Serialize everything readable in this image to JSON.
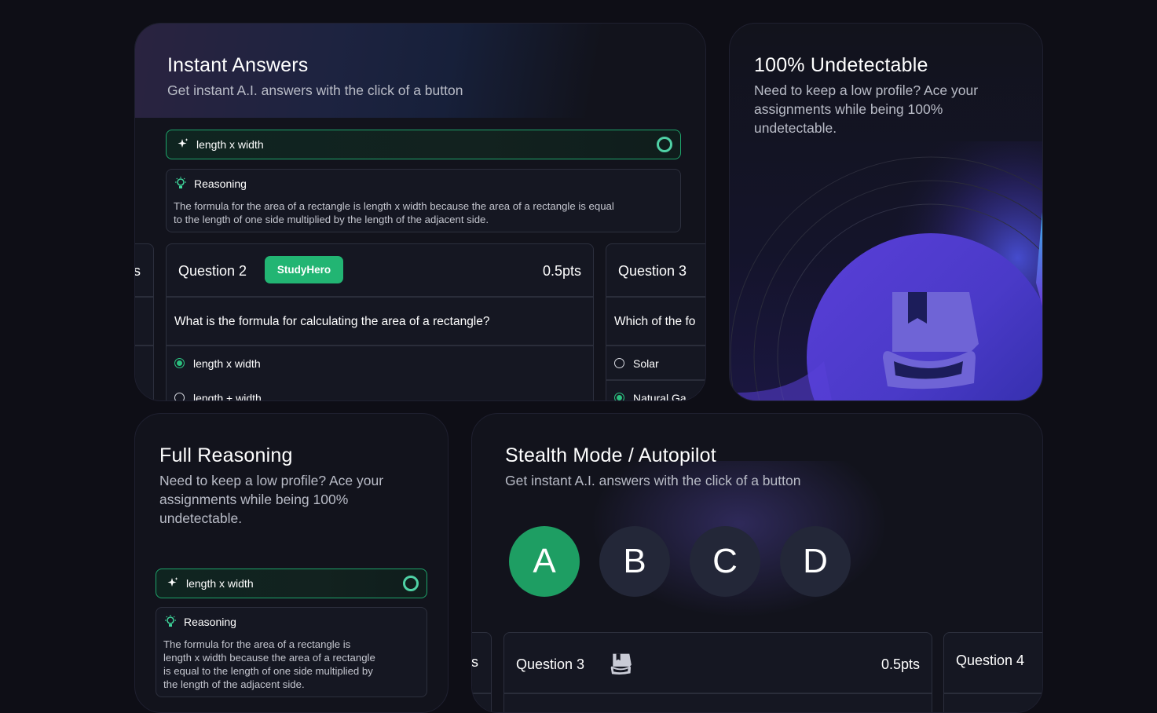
{
  "instant": {
    "title": "Instant Answers",
    "subtitle": "Get instant A.I. answers with the click of a button",
    "answer": "length x width",
    "reasoning_label": "Reasoning",
    "reasoning_line1": "The formula for the area of a rectangle is length x width because the area of a rectangle is equal",
    "reasoning_line2": "to the length of one side multiplied by the length of the adjacent side.",
    "prev_fragment": "s",
    "q2": {
      "title": "Question 2",
      "badge": "StudyHero",
      "pts": "0.5pts",
      "text": "What is the formula for calculating the area of a rectangle?",
      "options": [
        "length x width",
        "length + width"
      ]
    },
    "q3": {
      "title": "Question 3",
      "text": "Which of the fo",
      "options": [
        "Solar",
        "Natural Ga"
      ]
    }
  },
  "undetectable": {
    "title": "100% Undetectable",
    "line1": "Need to keep a low profile? Ace your",
    "line2": "assignments while being 100%",
    "line3": "undetectable.",
    "logo_icon": "studyhero-logo-icon"
  },
  "full": {
    "title": "Full Reasoning",
    "line1": "Need to keep a low profile? Ace your",
    "line2": "assignments while being 100%",
    "line3": "undetectable.",
    "answer": "length x width",
    "reasoning_label": "Reasoning",
    "reasoning_lines": [
      "The formula for the area of a rectangle is",
      "length x width because the area of a rectangle",
      "is equal to the length of one side multiplied by",
      "the length of the adjacent side."
    ]
  },
  "stealth": {
    "title": "Stealth Mode / Autopilot",
    "subtitle": "Get instant A.I. answers with the click of a button",
    "letters": [
      "A",
      "B",
      "C",
      "D"
    ],
    "selected": "A",
    "prev_fragment": "s",
    "q3": {
      "title": "Question 3",
      "pts": "0.5pts"
    },
    "q4": {
      "title": "Question 4"
    }
  },
  "colors": {
    "accent_green": "#22b573",
    "purple": "#6c5fd6",
    "background": "#0e0e16"
  }
}
